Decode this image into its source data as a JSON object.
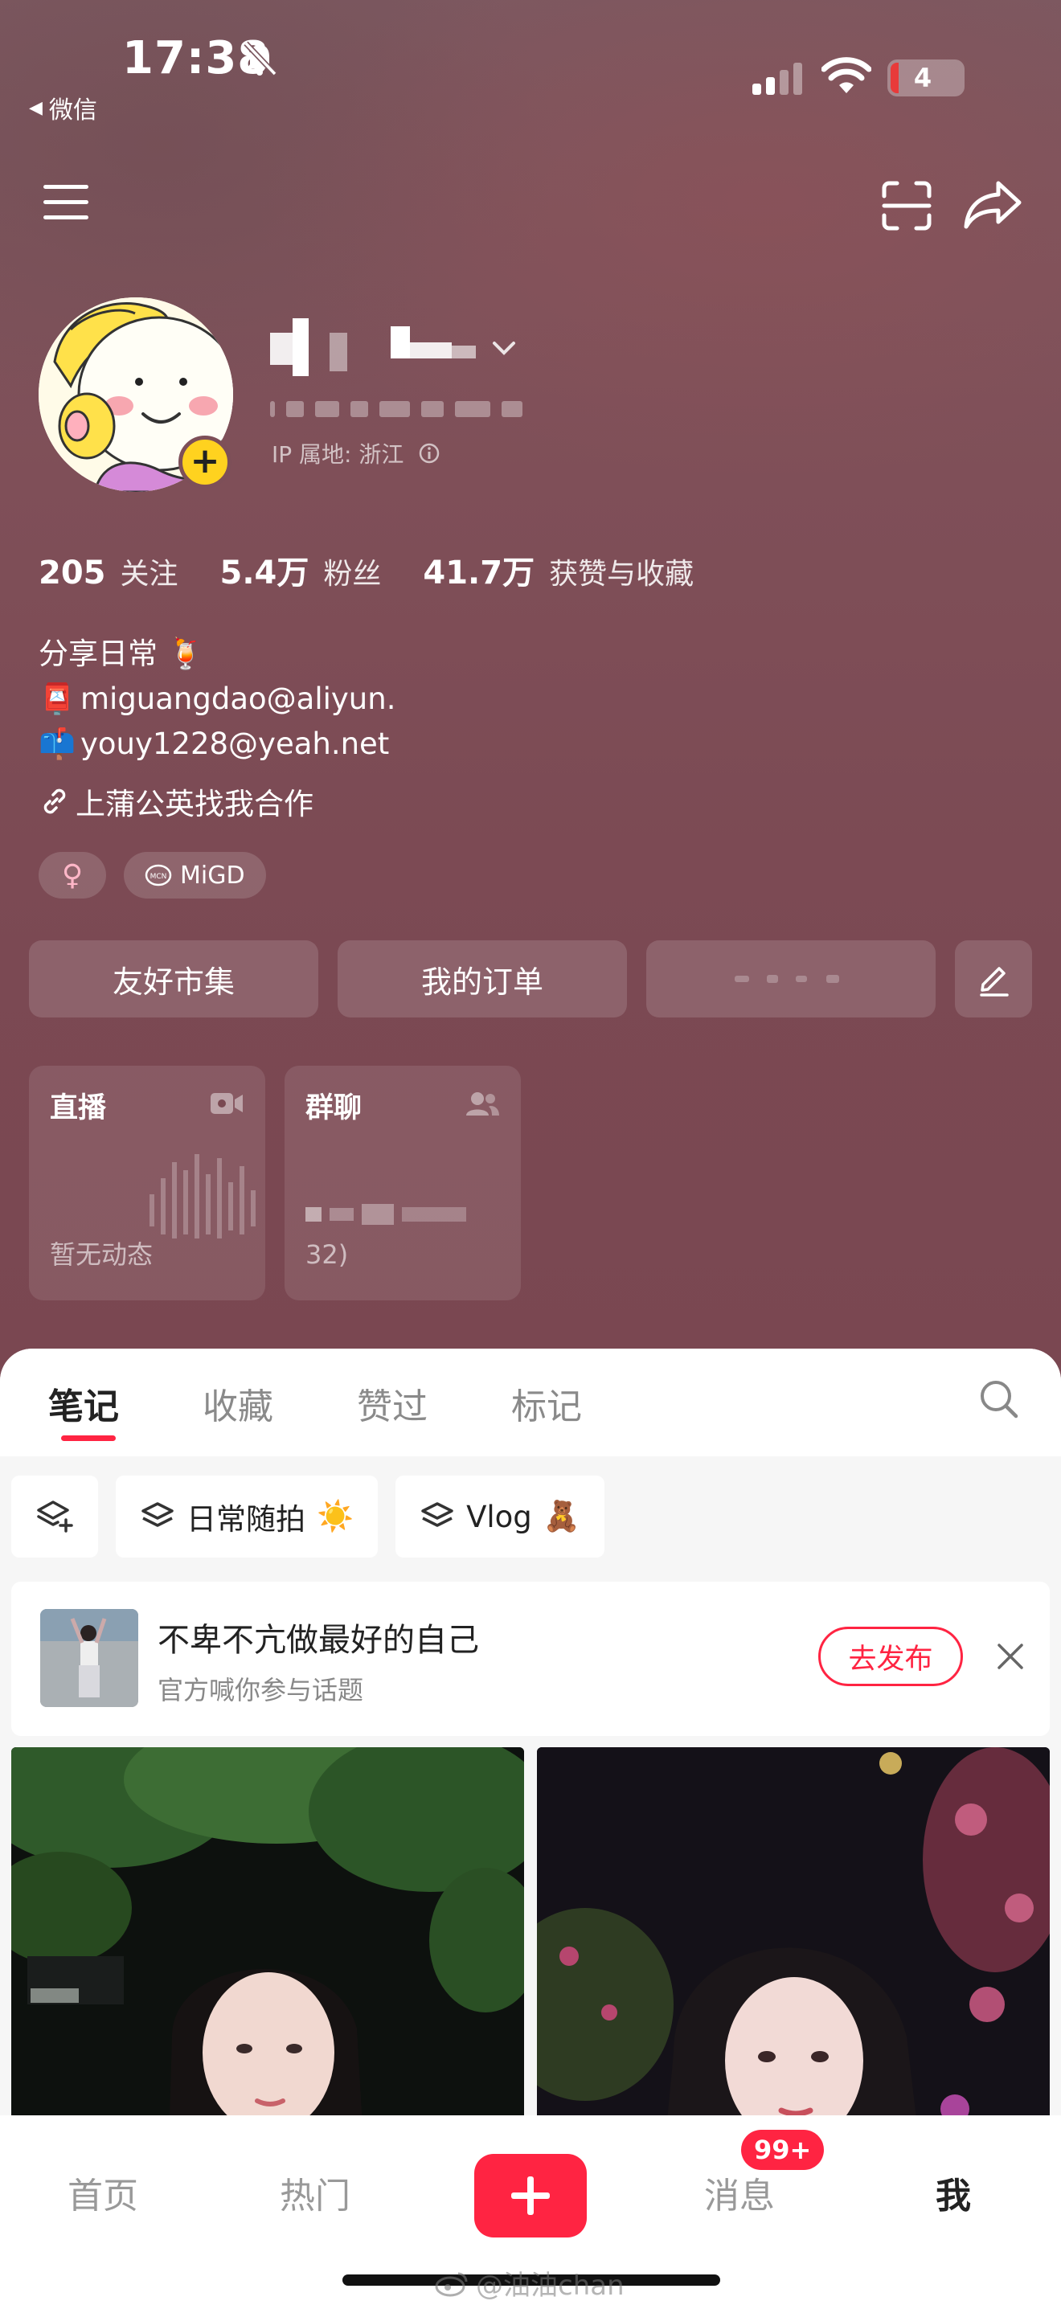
{
  "status_bar": {
    "time": "17:38",
    "back_app": "微信",
    "battery": "4"
  },
  "profile": {
    "ip_location": "IP 属地: 浙江",
    "stats": [
      {
        "num": "205",
        "label": "关注"
      },
      {
        "num": "5.4万",
        "label": "粉丝"
      },
      {
        "num": "41.7万",
        "label": "获赞与收藏"
      }
    ],
    "bio": {
      "line1": "分享日常",
      "line1_emoji": "🍹",
      "line2": "miguangdao@aliyun.",
      "line2_emoji": "📮",
      "line3": "youy1228@yeah.net",
      "line3_emoji": "📫"
    },
    "link": "上蒲公英找我合作",
    "tags": {
      "gender": "♀",
      "mcn": "MiGD"
    }
  },
  "actions": {
    "market": "友好市集",
    "orders": "我的订单"
  },
  "cards": {
    "live": {
      "title": "直播",
      "status": "暂无动态"
    },
    "group": {
      "title": "群聊",
      "sub_line2": "32)"
    }
  },
  "tabs": [
    "笔记",
    "收藏",
    "赞过",
    "标记"
  ],
  "filters": [
    {
      "label": "日常随拍",
      "emoji": "☀️"
    },
    {
      "label": "Vlog",
      "emoji": "🧸"
    }
  ],
  "topic": {
    "title": "不卑不亢做最好的自己",
    "subtitle": "官方喊你参与话题",
    "publish": "去发布"
  },
  "bottom_nav": {
    "home": "首页",
    "hot": "热门",
    "messages": "消息",
    "me": "我",
    "badge": "99+"
  },
  "watermark": "@油油chan",
  "colors": {
    "accent": "#ff2442",
    "hero_bg": "#7b4953",
    "add_avatar": "#ffd21f"
  }
}
